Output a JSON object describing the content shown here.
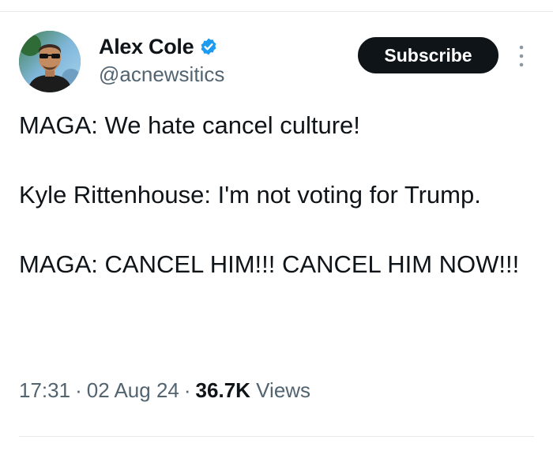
{
  "author": {
    "display_name": "Alex Cole",
    "handle": "@acnewsitics",
    "verified": true,
    "verified_color": "#1d9bf0"
  },
  "actions": {
    "subscribe_label": "Subscribe",
    "more_icon": "more-vertical-icon"
  },
  "tweet": {
    "paragraphs": [
      "MAGA: We hate cancel culture!",
      "Kyle Rittenhouse: I'm not voting for Trump.",
      "MAGA: CANCEL HIM!!! CANCEL HIM NOW!!!"
    ]
  },
  "meta": {
    "time": "17:31",
    "date": "02 Aug 24",
    "views_count": "36.7K",
    "views_label": "Views",
    "separator": "·"
  },
  "colors": {
    "text_primary": "#0f1419",
    "text_secondary": "#536471",
    "button_bg": "#0f1419",
    "divider": "#e7e9ea"
  }
}
